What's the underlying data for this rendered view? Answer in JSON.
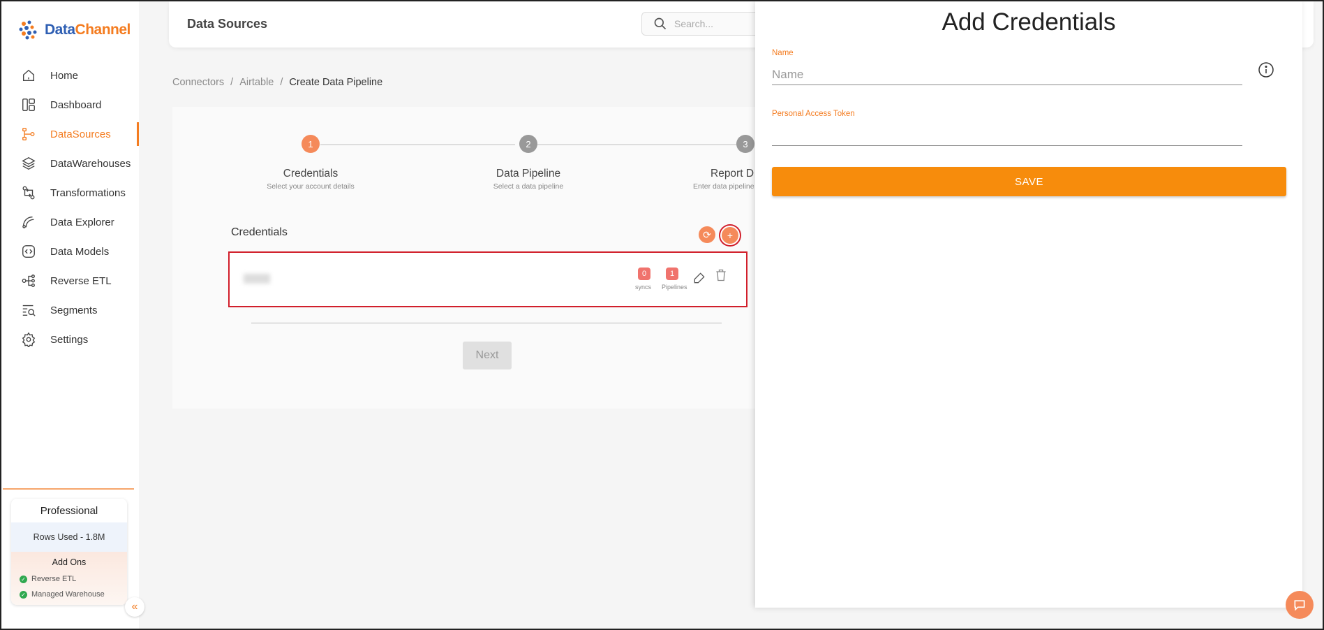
{
  "app": {
    "logo_part1": "Data",
    "logo_part2": "Channel"
  },
  "sidebar": {
    "items": [
      {
        "label": "Home",
        "icon": "home-icon"
      },
      {
        "label": "Dashboard",
        "icon": "dashboard-icon"
      },
      {
        "label": "DataSources",
        "icon": "datasources-icon",
        "active": true
      },
      {
        "label": "DataWarehouses",
        "icon": "layers-icon"
      },
      {
        "label": "Transformations",
        "icon": "transform-icon"
      },
      {
        "label": "Data Explorer",
        "icon": "explorer-icon"
      },
      {
        "label": "Data Models",
        "icon": "models-icon"
      },
      {
        "label": "Reverse ETL",
        "icon": "reverse-etl-icon"
      },
      {
        "label": "Segments",
        "icon": "segments-icon"
      },
      {
        "label": "Settings",
        "icon": "gear-icon"
      }
    ],
    "plan": {
      "name": "Professional",
      "rows_used": "Rows Used - 1.8M",
      "addons_title": "Add Ons",
      "addons": [
        "Reverse ETL",
        "Managed Warehouse"
      ]
    }
  },
  "header": {
    "title": "Data Sources",
    "search_placeholder": "Search..."
  },
  "breadcrumb": {
    "items": [
      "Connectors",
      "Airtable",
      "Create Data Pipeline"
    ],
    "separator": "/"
  },
  "stepper": {
    "steps": [
      {
        "number": "1",
        "title": "Credentials",
        "subtitle": "Select your account details"
      },
      {
        "number": "2",
        "title": "Data Pipeline",
        "subtitle": "Select a data pipeline"
      },
      {
        "number": "3",
        "title": "Report D",
        "subtitle": "Enter data pipeline"
      }
    ]
  },
  "credentials": {
    "title": "Credentials",
    "row": {
      "syncs_count": "0",
      "syncs_label": "syncs",
      "pipelines_count": "1",
      "pipelines_label": "Pipelines"
    },
    "next_label": "Next"
  },
  "drawer": {
    "title": "Add Credentials",
    "name_label": "Name",
    "name_placeholder": "Name",
    "token_label": "Personal Access Token",
    "token_value": "",
    "save_label": "SAVE"
  },
  "colors": {
    "accent": "#f47c20",
    "save_button": "#f78c0c",
    "badge": "#f0736d",
    "highlight_border": "#d11f2b"
  }
}
